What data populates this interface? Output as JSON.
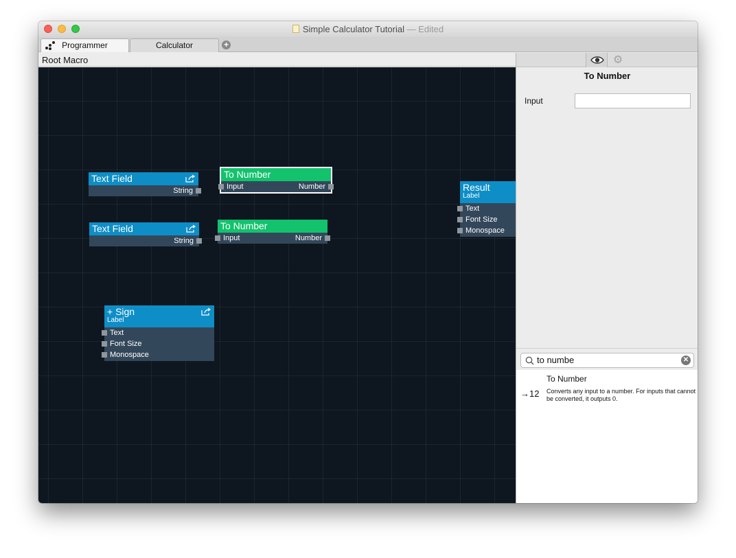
{
  "window": {
    "title": "Simple Calculator Tutorial",
    "separator": "—",
    "status": "Edited"
  },
  "tabs": [
    {
      "label": "Programmer",
      "active": true
    },
    {
      "label": "Calculator",
      "active": false
    }
  ],
  "add_tab_icon": "plus-icon",
  "breadcrumb": "Root Macro",
  "canvas": {
    "nodes": {
      "text_field_1": {
        "title": "Text Field",
        "output": "String"
      },
      "text_field_2": {
        "title": "Text Field",
        "output": "String"
      },
      "to_number_1": {
        "title": "To Number",
        "input": "Input",
        "output": "Number",
        "selected": true
      },
      "to_number_2": {
        "title": "To Number",
        "input": "Input",
        "output": "Number"
      },
      "plus_sign": {
        "title": "+ Sign",
        "subtitle": "Label",
        "inputs": [
          "Text",
          "Font Size",
          "Monospace"
        ]
      },
      "result": {
        "title": "Result",
        "subtitle": "Label",
        "inputs": [
          "Text",
          "Font Size",
          "Monospace"
        ]
      }
    }
  },
  "inspector": {
    "title": "To Number",
    "field_label": "Input",
    "field_value": "",
    "toolbar_icons": [
      "eye-icon",
      "gear-icon"
    ]
  },
  "search": {
    "value": "to numbe",
    "results": [
      {
        "glyph": "→12",
        "name": "To Number",
        "description": "Converts any input to a number. For inputs that cannot be converted, it outputs 0."
      }
    ]
  },
  "colors": {
    "canvas_bg": "#0e1720",
    "node_blue": "#0e8ec7",
    "node_green": "#13c26d",
    "node_body": "#33475a"
  }
}
